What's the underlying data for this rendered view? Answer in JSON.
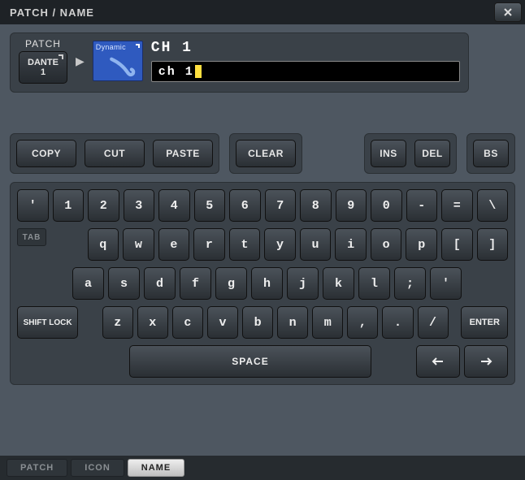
{
  "title": "PATCH / NAME",
  "patch": {
    "label": "PATCH",
    "source": {
      "line1": "DANTE",
      "line2": "1"
    },
    "icon_tag": "Dynamic",
    "channel_label": "CH 1",
    "name_value": "ch 1"
  },
  "edit": {
    "copy": "COPY",
    "cut": "CUT",
    "paste": "PASTE",
    "clear": "CLEAR",
    "ins": "INS",
    "del": "DEL",
    "bs": "BS"
  },
  "keyboard": {
    "row1": [
      "'",
      "1",
      "2",
      "3",
      "4",
      "5",
      "6",
      "7",
      "8",
      "9",
      "0",
      "-",
      "=",
      "\\"
    ],
    "row2": [
      "q",
      "w",
      "e",
      "r",
      "t",
      "y",
      "u",
      "i",
      "o",
      "p",
      "[",
      "]"
    ],
    "row3": [
      "a",
      "s",
      "d",
      "f",
      "g",
      "h",
      "j",
      "k",
      "l",
      ";",
      "'"
    ],
    "row4": [
      "z",
      "x",
      "c",
      "v",
      "b",
      "n",
      "m",
      ",",
      ".",
      "/"
    ],
    "tab": "TAB",
    "shift": "SHIFT LOCK",
    "enter": "ENTER",
    "space": "SPACE"
  },
  "tabs": {
    "patch": "PATCH",
    "icon": "ICON",
    "name": "NAME"
  }
}
